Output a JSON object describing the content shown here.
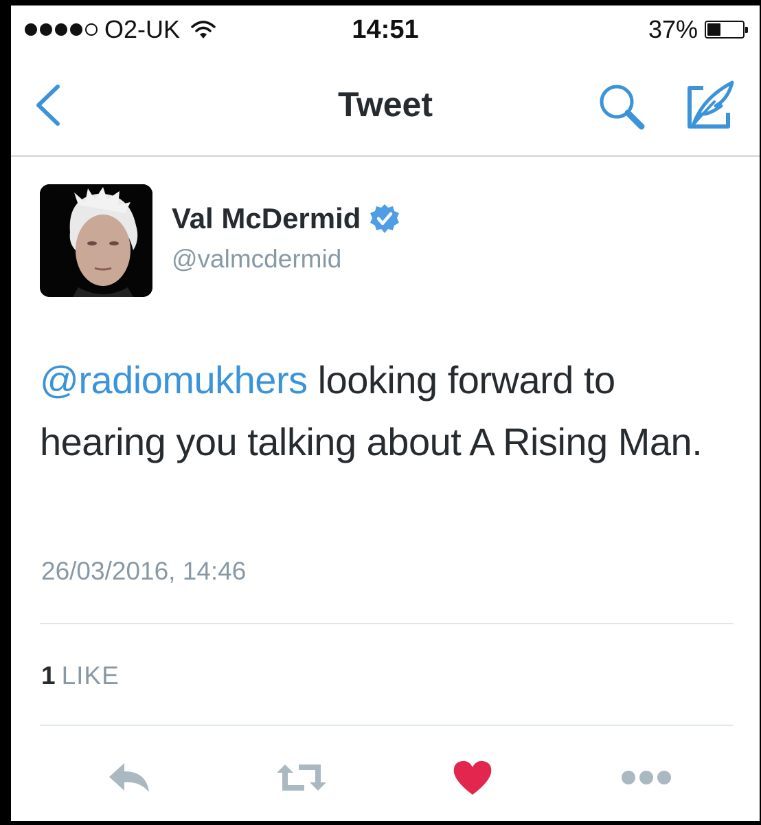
{
  "status_bar": {
    "carrier": "O2-UK",
    "time": "14:51",
    "battery_percent_label": "37%",
    "battery_level": 0.37,
    "signal_bars": 4
  },
  "nav": {
    "title": "Tweet",
    "icons": [
      "back-chevron-icon",
      "search-icon",
      "compose-icon"
    ]
  },
  "tweet": {
    "user_name": "Val McDermid",
    "handle": "@valmcdermid",
    "verified": true,
    "mention": "@radiomukhers",
    "text": " looking forward to hearing you talking about A Rising Man.",
    "timestamp": "26/03/2016, 14:46",
    "like_count": "1",
    "like_label": "LIKE"
  },
  "actions": [
    "reply-icon",
    "retweet-icon",
    "like-heart-icon",
    "more-icon"
  ],
  "colors": {
    "accent": "#3b94d9",
    "text": "#262b30",
    "secondary_text": "#8899a6",
    "like": "#e2264d",
    "action_gray": "#aab8c2"
  }
}
